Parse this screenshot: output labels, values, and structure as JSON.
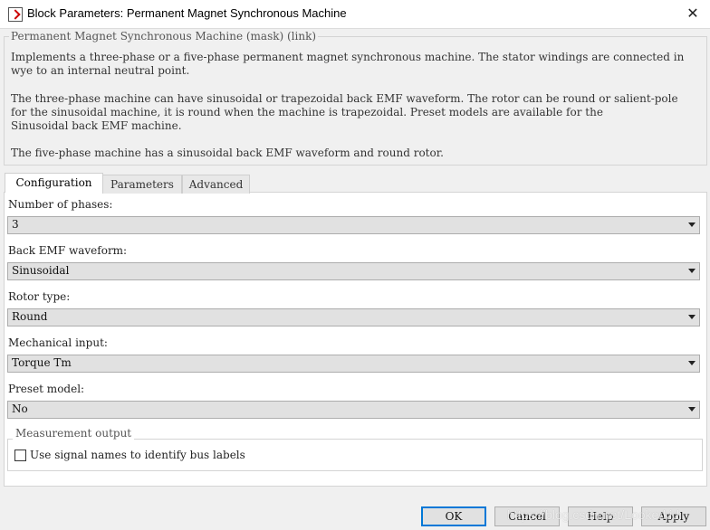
{
  "window": {
    "title": "Block Parameters: Permanent Magnet Synchronous Machine",
    "close": "✕"
  },
  "mask": {
    "legend": "Permanent Magnet Synchronous Machine (mask) (link)",
    "p1": "Implements a three-phase or a five-phase permanent magnet synchronous machine. The stator windings are connected in\nwye to an internal neutral point.",
    "p2": "The three-phase machine can have sinusoidal or trapezoidal back EMF waveform. The rotor can be round or salient-pole\nfor the sinusoidal machine, it is round when the machine is trapezoidal. Preset models are available for the\nSinusoidal back EMF machine.",
    "p3": "The five-phase machine has a sinusoidal back EMF waveform and round rotor."
  },
  "tabs": [
    "Configuration",
    "Parameters",
    "Advanced"
  ],
  "fields": [
    {
      "label": "Number of phases:",
      "value": "3"
    },
    {
      "label": "Back EMF waveform:",
      "value": "Sinusoidal"
    },
    {
      "label": "Rotor type:",
      "value": "Round"
    },
    {
      "label": "Mechanical input:",
      "value": "Torque Tm"
    },
    {
      "label": "Preset model:",
      "value": "No"
    }
  ],
  "measurement": {
    "legend": "Measurement output",
    "checkbox_label": "Use signal names to identify bus labels",
    "checked": false
  },
  "buttons": {
    "ok": "OK",
    "cancel": "Cancel",
    "help": "Help",
    "apply": "Apply"
  },
  "watermark": "https://blog.csdn.net/Lookerkid"
}
